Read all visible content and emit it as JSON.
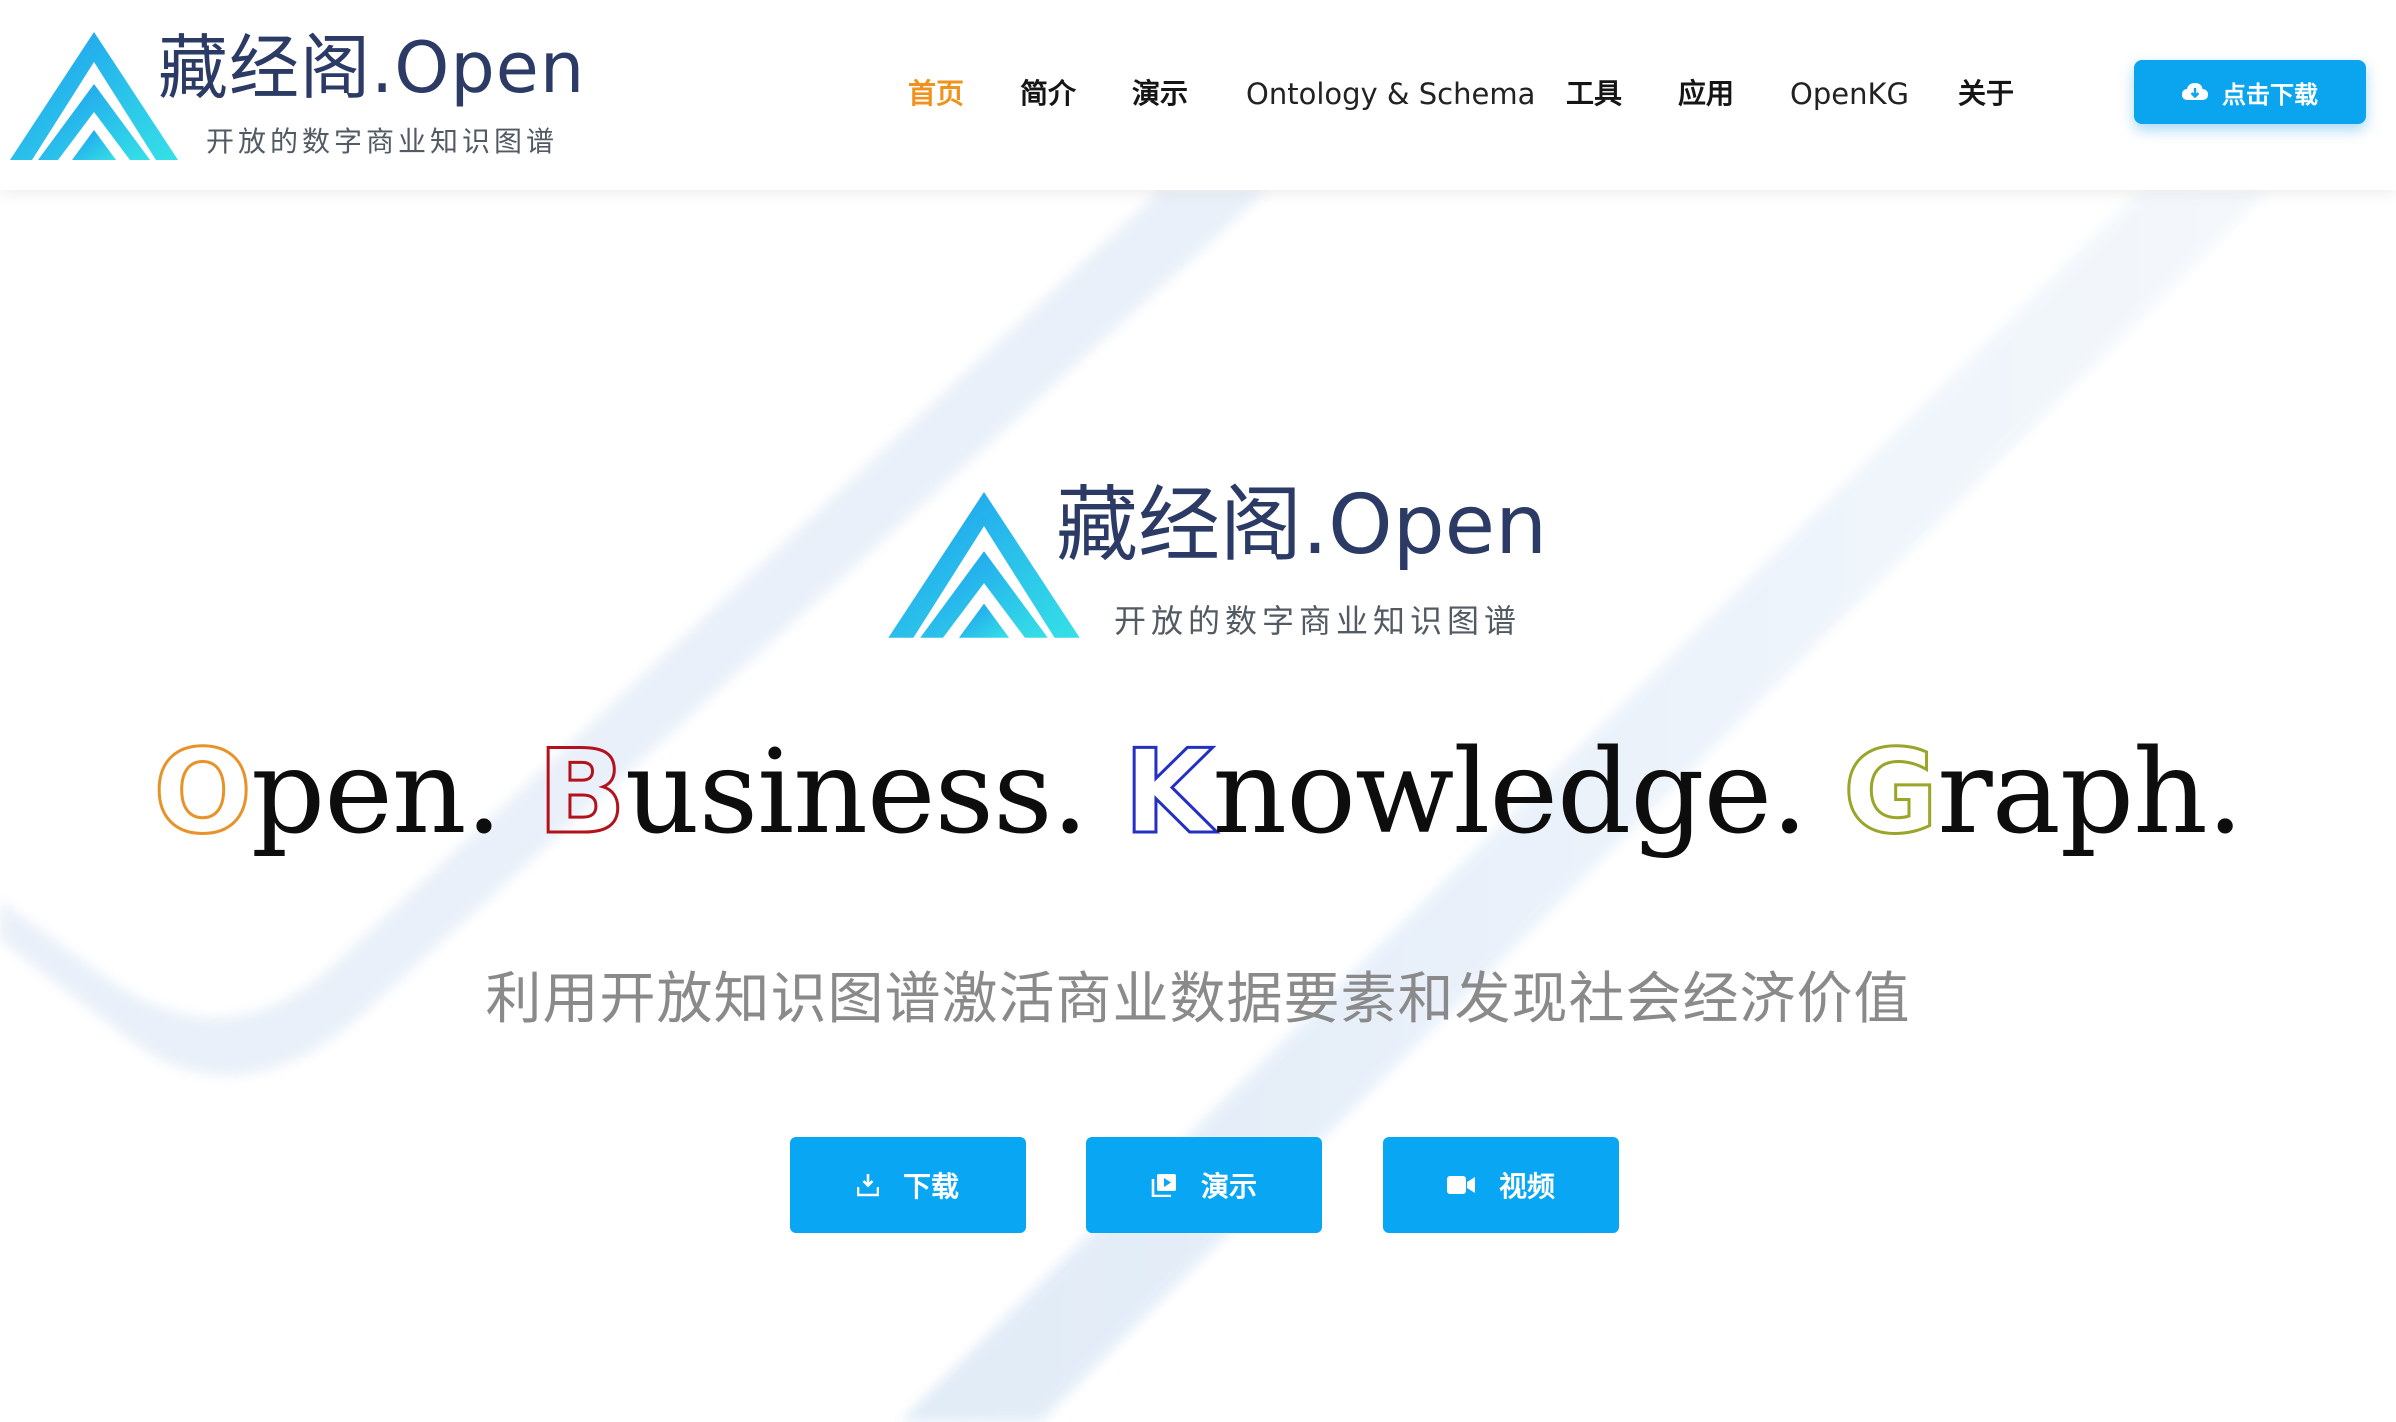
{
  "header": {
    "logo": {
      "title_cn": "藏经阁",
      "title_suffix": ".Open",
      "subtitle": "开放的数字商业知识图谱"
    },
    "nav": [
      {
        "label": "首页",
        "active": true
      },
      {
        "label": "简介"
      },
      {
        "label": "演示"
      },
      {
        "label": "Ontology & Schema"
      },
      {
        "label": "工具"
      },
      {
        "label": "应用"
      },
      {
        "label": "OpenKG"
      },
      {
        "label": "关于"
      }
    ],
    "download_button": {
      "label": "点击下载",
      "icon": "cloud-download-icon"
    }
  },
  "hero": {
    "logo": {
      "title_cn": "藏经阁",
      "title_suffix": ".Open",
      "subtitle": "开放的数字商业知识图谱"
    },
    "tagline": [
      {
        "cap": "O",
        "rest": "pen.",
        "color": "#e8932a"
      },
      {
        "cap": "B",
        "rest": "usiness.",
        "color": "#b3121c"
      },
      {
        "cap": "K",
        "rest": "nowledge.",
        "color": "#2430c4"
      },
      {
        "cap": "G",
        "rest": "raph.",
        "color": "#9aa52a"
      }
    ],
    "subtitle": "利用开放知识图谱激活商业数据要素和发现社会经济价值",
    "buttons": [
      {
        "label": "下载",
        "icon": "download-icon"
      },
      {
        "label": "演示",
        "icon": "slides-icon"
      },
      {
        "label": "视频",
        "icon": "video-camera-icon"
      }
    ]
  },
  "colors": {
    "accent": "#0aa5ee",
    "nav_active": "#f0931e",
    "logo_text": "#2b3b66"
  }
}
